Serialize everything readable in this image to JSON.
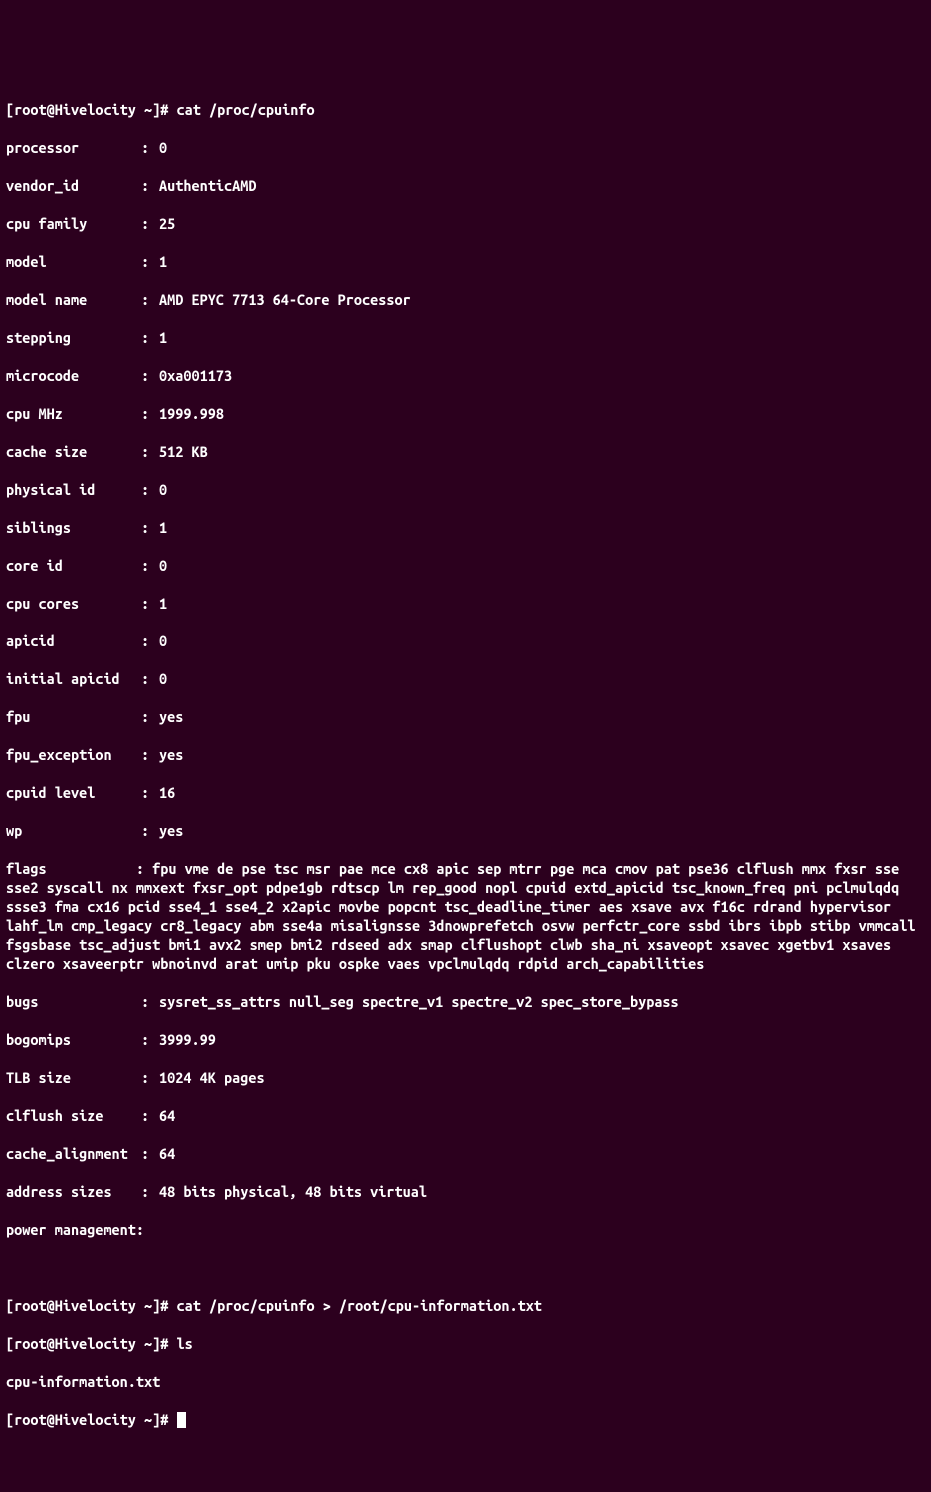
{
  "prompts": {
    "p1": "[root@Hivelocity ~]# ",
    "cmd1": "cat /proc/cpuinfo",
    "p2": "[root@Hivelocity ~]# ",
    "cmd2": "cat /proc/cpuinfo > /root/cpu-information.txt",
    "p3": "[root@Hivelocity ~]# ",
    "cmd3": "ls",
    "ls_output": "cpu-information.txt",
    "p4": "[root@Hivelocity ~]# "
  },
  "cpuinfo": {
    "processor": {
      "key": "processor",
      "sep": ":",
      "val": "0"
    },
    "vendor_id": {
      "key": "vendor_id",
      "sep": ":",
      "val": "AuthenticAMD"
    },
    "cpu_family": {
      "key": "cpu family",
      "sep": ":",
      "val": "25"
    },
    "model": {
      "key": "model",
      "sep": ":",
      "val": "1"
    },
    "model_name": {
      "key": "model name",
      "sep": ":",
      "val": "AMD EPYC 7713 64-Core Processor"
    },
    "stepping": {
      "key": "stepping",
      "sep": ":",
      "val": "1"
    },
    "microcode": {
      "key": "microcode",
      "sep": ":",
      "val": "0xa001173"
    },
    "cpu_mhz": {
      "key": "cpu MHz",
      "sep": ":",
      "val": "1999.998"
    },
    "cache_size": {
      "key": "cache size",
      "sep": ":",
      "val": "512 KB"
    },
    "physical_id": {
      "key": "physical id",
      "sep": ":",
      "val": "0"
    },
    "siblings": {
      "key": "siblings",
      "sep": ":",
      "val": "1"
    },
    "core_id": {
      "key": "core id",
      "sep": ":",
      "val": "0"
    },
    "cpu_cores": {
      "key": "cpu cores",
      "sep": ":",
      "val": "1"
    },
    "apicid": {
      "key": "apicid",
      "sep": ":",
      "val": "0"
    },
    "initial_apicid": {
      "key": "initial apicid",
      "sep": ":",
      "val": "0"
    },
    "fpu": {
      "key": "fpu",
      "sep": ":",
      "val": "yes"
    },
    "fpu_exception": {
      "key": "fpu_exception",
      "sep": ":",
      "val": "yes"
    },
    "cpuid_level": {
      "key": "cpuid level",
      "sep": ":",
      "val": "16"
    },
    "wp": {
      "key": "wp",
      "sep": ":",
      "val": "yes"
    },
    "flags": "flags           : fpu vme de pse tsc msr pae mce cx8 apic sep mtrr pge mca cmov pat pse36 clflush mmx fxsr sse sse2 syscall nx mmxext fxsr_opt pdpe1gb rdtscp lm rep_good nopl cpuid extd_apicid tsc_known_freq pni pclmulqdq ssse3 fma cx16 pcid sse4_1 sse4_2 x2apic movbe popcnt tsc_deadline_timer aes xsave avx f16c rdrand hypervisor lahf_lm cmp_legacy cr8_legacy abm sse4a misalignsse 3dnowprefetch osvw perfctr_core ssbd ibrs ibpb stibp vmmcall fsgsbase tsc_adjust bmi1 avx2 smep bmi2 rdseed adx smap clflushopt clwb sha_ni xsaveopt xsavec xgetbv1 xsaves clzero xsaveerptr wbnoinvd arat umip pku ospke vaes vpclmulqdq rdpid arch_capabilities",
    "bugs": {
      "key": "bugs",
      "sep": ":",
      "val": "sysret_ss_attrs null_seg spectre_v1 spectre_v2 spec_store_bypass"
    },
    "bogomips": {
      "key": "bogomips",
      "sep": ":",
      "val": "3999.99"
    },
    "tlb_size": {
      "key": "TLB size",
      "sep": ":",
      "val": "1024 4K pages"
    },
    "clflush_size": {
      "key": "clflush size",
      "sep": ":",
      "val": "64"
    },
    "cache_alignment": {
      "key": "cache_alignment",
      "sep": ":",
      "val": "64"
    },
    "address_sizes": {
      "key": "address sizes",
      "sep": ":",
      "val": "48 bits physical, 48 bits virtual"
    },
    "power_management": {
      "key": "power management:",
      "sep": "",
      "val": ""
    }
  }
}
